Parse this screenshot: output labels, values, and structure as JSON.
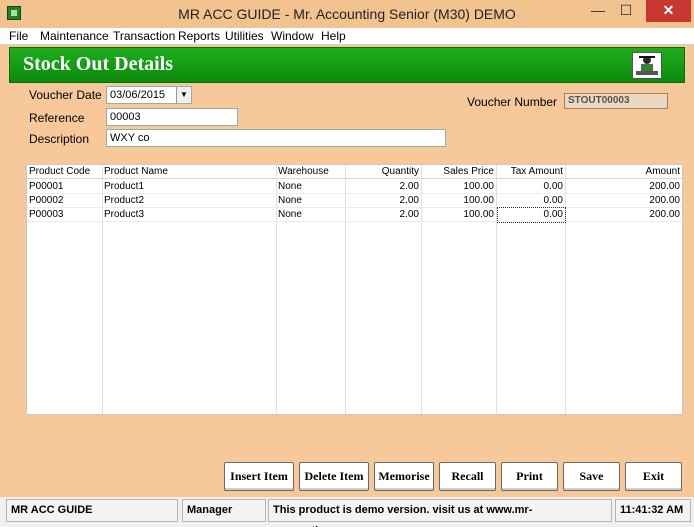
{
  "window": {
    "title": "MR ACC GUIDE - Mr. Accounting Senior (M30) DEMO",
    "min_glyph": "—",
    "max_glyph": "☐",
    "close_glyph": "✕"
  },
  "menu": [
    "File",
    "Maintenance",
    "Transaction",
    "Reports",
    "Utilities",
    "Window",
    "Help"
  ],
  "header": {
    "title": "Stock Out Details",
    "logo_icon": "accountant-logo-icon"
  },
  "form": {
    "voucher_date_label": "Voucher Date",
    "voucher_date_value": "03/06/2015",
    "reference_label": "Reference",
    "reference_value": "00003",
    "description_label": "Description",
    "description_value": "WXY co",
    "voucher_number_label": "Voucher Number",
    "voucher_number_value": "STOUT00003"
  },
  "grid": {
    "columns": [
      "Product Code",
      "Product Name",
      "Warehouse",
      "Quantity",
      "Sales Price",
      "Tax Amount",
      "Amount"
    ],
    "rows": [
      [
        "P00001",
        "Product1",
        "None",
        "2.00",
        "100.00",
        "0.00",
        "200.00"
      ],
      [
        "P00002",
        "Product2",
        "None",
        "2.00",
        "100.00",
        "0.00",
        "200.00"
      ],
      [
        "P00003",
        "Product3",
        "None",
        "2.00",
        "100.00",
        "0.00",
        "200.00"
      ]
    ]
  },
  "buttons": {
    "insert_item": "Insert Item",
    "delete_item": "Delete Item",
    "memorise": "Memorise",
    "recall": "Recall",
    "print": "Print",
    "save": "Save",
    "exit": "Exit"
  },
  "status": {
    "company": "MR ACC GUIDE",
    "user": "Manager",
    "message": "This product is demo version.  visit us at www.mr-accounting.com",
    "time": "11:41:32 AM"
  },
  "colors": {
    "background": "#f6c89a",
    "header_green": "#13a013",
    "close_red": "#c7372f"
  }
}
